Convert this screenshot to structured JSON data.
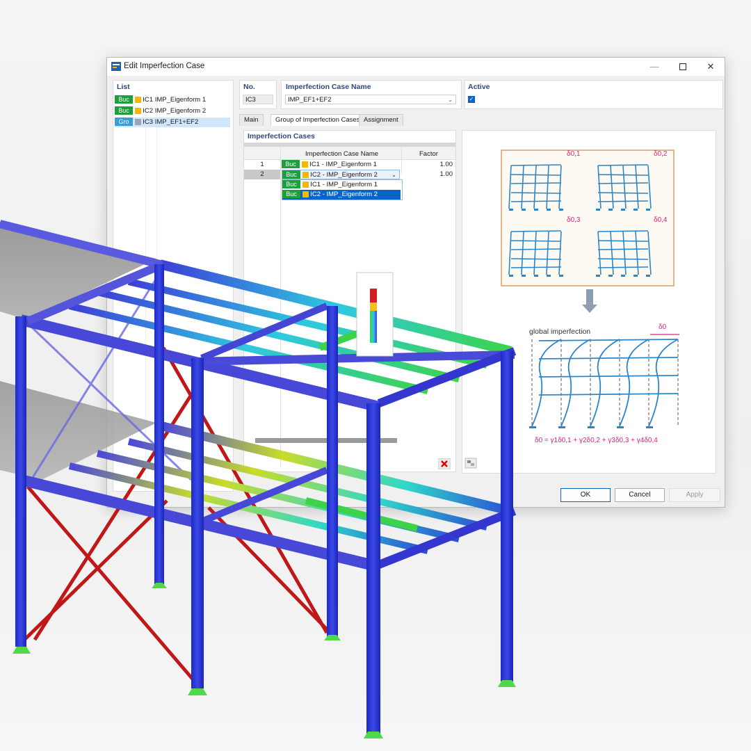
{
  "dialog": {
    "title": "Edit Imperfection Case",
    "min": "—",
    "max": "☐",
    "close": "✕"
  },
  "list": {
    "header": "List",
    "items": [
      {
        "badge": "Buc",
        "badge_color": "#1f9e3e",
        "swatch": "#f5b800",
        "label": "IC1 IMP_Eigenform 1"
      },
      {
        "badge": "Buc",
        "badge_color": "#1f9e3e",
        "swatch": "#f5b800",
        "label": "IC2 IMP_Eigenform 2"
      },
      {
        "badge": "Gro",
        "badge_color": "#3d9bd6",
        "swatch": "#9aa6b5",
        "label": "IC3 IMP_EF1+EF2"
      }
    ]
  },
  "no": {
    "header": "No.",
    "value": "IC3"
  },
  "name": {
    "header": "Imperfection Case Name",
    "value": "IMP_EF1+EF2"
  },
  "active": {
    "header": "Active",
    "checked": true
  },
  "tabs": [
    "Main",
    "Group of Imperfection Cases",
    "Assignment"
  ],
  "cases": {
    "header": "Imperfection Cases",
    "col_name": "Imperfection Case Name",
    "col_factor": "Factor",
    "rows": [
      {
        "num": "1",
        "badge": "Buc",
        "label": "IC1 - IMP_Eigenform 1",
        "factor": "1.00"
      },
      {
        "num": "2",
        "badge": "Buc",
        "label": "IC2 - IMP_Eigenform 2",
        "factor": "1.00"
      }
    ],
    "dropdown": [
      {
        "badge": "Buc",
        "label": "IC1 - IMP_Eigenform 1"
      },
      {
        "badge": "Buc",
        "label": "IC2 - IMP_Eigenform 2"
      }
    ]
  },
  "figure": {
    "delta_labels": [
      "δ0,1",
      "δ0,2",
      "δ0,3",
      "δ0,4"
    ],
    "global_label": "global imperfection",
    "delta0": "δ0",
    "formula": "δ0 = γ1δ0,1 + γ2δ0,2 + γ3δ0,3 + γ4δ0,4"
  },
  "buttons": {
    "ok": "OK",
    "cancel": "Cancel",
    "apply": "Apply"
  },
  "colors": {
    "accent": "#0a64c8",
    "badge_green": "#1f9e3e",
    "badge_blue": "#3d9bd6",
    "formula": "#e0207a",
    "frame": "#2b86c8"
  }
}
